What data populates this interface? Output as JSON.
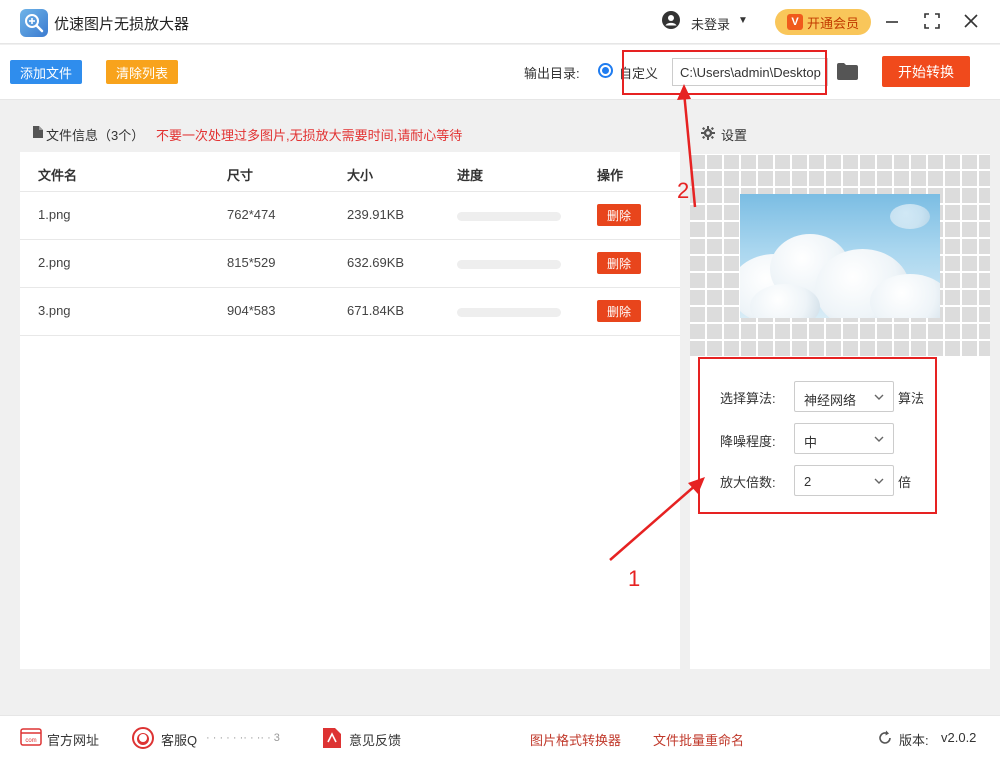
{
  "titlebar": {
    "app_title": "优速图片无损放大器",
    "login_text": "未登录",
    "vip_label": "开通会员",
    "vip_badge": "V"
  },
  "toolbar": {
    "add_label": "添加文件",
    "clear_label": "清除列表",
    "output_label": "输出目录:",
    "custom_label": "自定义",
    "output_path": "C:\\Users\\admin\\Desktop",
    "start_label": "开始转换"
  },
  "file_list": {
    "info_title": "文件信息（3个）",
    "warning": "不要一次处理过多图片,无损放大需要时间,请耐心等待",
    "columns": [
      "文件名",
      "尺寸",
      "大小",
      "进度",
      "操作"
    ],
    "rows": [
      {
        "name": "1.png",
        "size": "762*474",
        "filesize": "239.91KB",
        "progress": 0,
        "action": "删除"
      },
      {
        "name": "2.png",
        "size": "815*529",
        "filesize": "632.69KB",
        "progress": 0,
        "action": "删除"
      },
      {
        "name": "3.png",
        "size": "904*583",
        "filesize": "671.84KB",
        "progress": 0,
        "action": "删除"
      }
    ]
  },
  "settings": {
    "title": "设置",
    "algorithm_label": "选择算法:",
    "algorithm_value": "神经网络",
    "algorithm_suffix": "算法",
    "denoise_label": "降噪程度:",
    "denoise_value": "中",
    "scale_label": "放大倍数:",
    "scale_value": "2",
    "scale_suffix": "倍"
  },
  "annotations": {
    "num1": "1",
    "num2": "2",
    "color": "#e62222"
  },
  "footer": {
    "website": "官方网址",
    "service": "客服Q",
    "service_masked": "· · · · · ·· · ·· · 3",
    "feedback": "意见反馈",
    "converter": "图片格式转换器",
    "rename": "文件批量重命名",
    "version_label": "版本:",
    "version": "v2.0.2"
  },
  "colors": {
    "accent_blue": "#2f8ded",
    "orange": "#f8a31c",
    "start_red": "#f04a1c",
    "delete_red": "#e8451c",
    "warn_red": "#e23232"
  }
}
